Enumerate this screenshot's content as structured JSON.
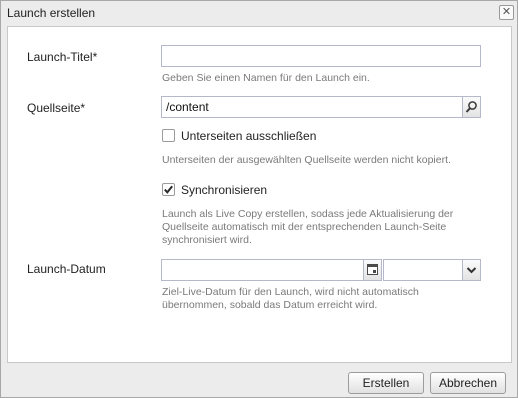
{
  "dialog": {
    "title": "Launch erstellen",
    "close_icon": "close-icon"
  },
  "form": {
    "launch_title": {
      "label": "Launch-Titel",
      "required_mark": "*",
      "value": "",
      "help": "Geben Sie einen Namen für den Launch ein."
    },
    "source_page": {
      "label": "Quellseite",
      "required_mark": "*",
      "value": "/content",
      "browse_icon": "search-icon"
    },
    "exclude_subpages": {
      "label": "Unterseiten ausschließen",
      "checked": false,
      "help": "Unterseiten der ausgewählten Quellseite werden nicht kopiert."
    },
    "synchronize": {
      "label": "Synchronisieren",
      "checked": true,
      "help_lines": [
        "Launch als Live Copy erstellen, sodass jede Aktualisierung der",
        "Quellseite automatisch mit der entsprechenden Launch-Seite",
        "synchronisiert wird."
      ]
    },
    "launch_date": {
      "label": "Launch-Datum",
      "date_value": "",
      "time_value": "",
      "calendar_icon": "calendar-icon",
      "dropdown_icon": "chevron-down-icon",
      "help_lines": [
        "Ziel-Live-Datum für den Launch, wird nicht automatisch",
        "übernommen, sobald das Datum erreicht wird."
      ]
    }
  },
  "footer": {
    "create_label": "Erstellen",
    "cancel_label": "Abbrechen"
  }
}
